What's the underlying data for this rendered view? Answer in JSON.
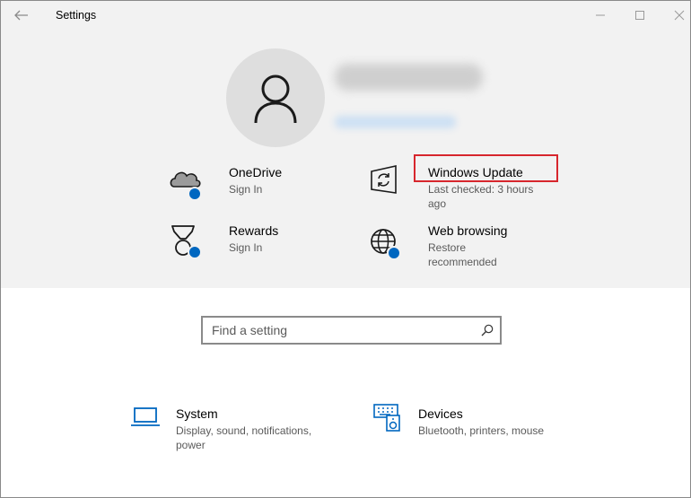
{
  "window": {
    "title": "Settings"
  },
  "quick_tiles": [
    {
      "title": "OneDrive",
      "subtitle": "Sign In",
      "icon": "onedrive-cloud-icon"
    },
    {
      "title": "Windows Update",
      "subtitle": "Last checked: 3 hours ago",
      "icon": "windows-update-icon"
    },
    {
      "title": "Rewards",
      "subtitle": "Sign In",
      "icon": "rewards-medal-icon"
    },
    {
      "title": "Web browsing",
      "subtitle": "Restore recommended",
      "icon": "globe-icon"
    }
  ],
  "search": {
    "placeholder": "Find a setting"
  },
  "categories": [
    {
      "title": "System",
      "subtitle": "Display, sound, notifications, power",
      "icon": "laptop-icon"
    },
    {
      "title": "Devices",
      "subtitle": "Bluetooth, printers, mouse",
      "icon": "keyboard-speaker-icon"
    }
  ],
  "colors": {
    "accent": "#0067c0",
    "highlight": "#d7262d",
    "hero_background": "#f2f2f2"
  }
}
